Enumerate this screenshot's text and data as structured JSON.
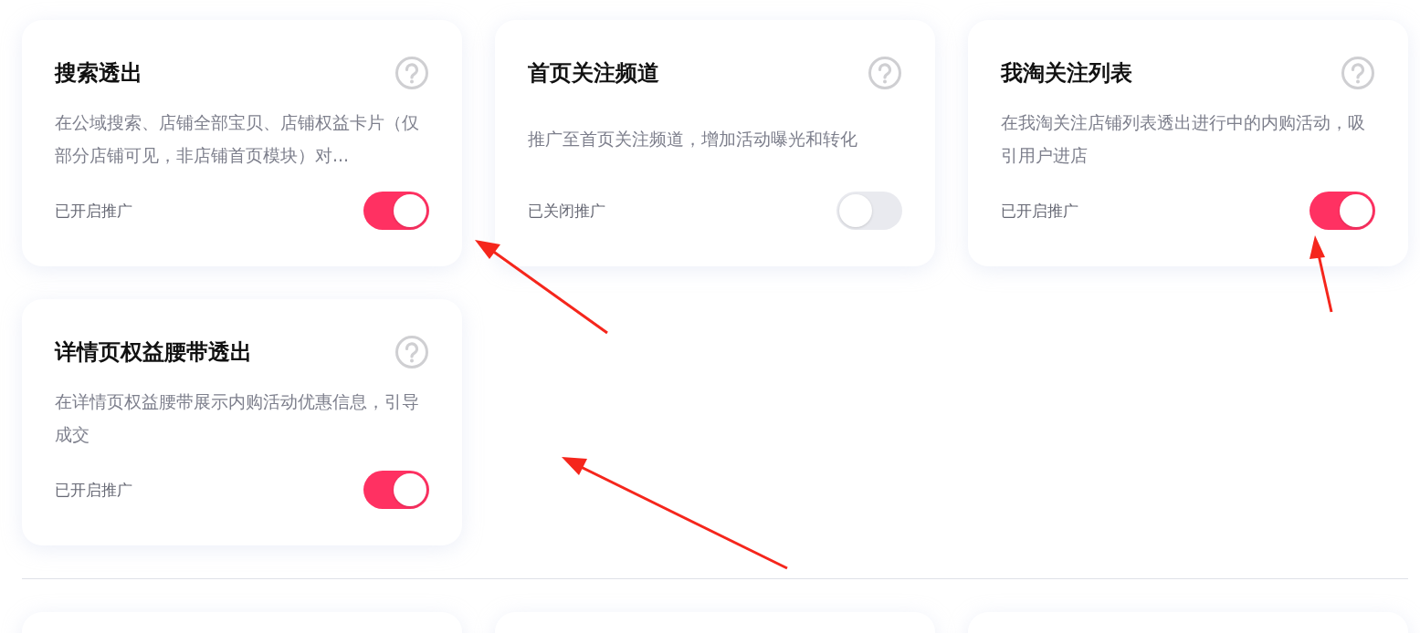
{
  "cards": [
    {
      "title": "搜索透出",
      "description": "在公域搜索、店铺全部宝贝、店铺权益卡片（仅部分店铺可见，非店铺首页模块）对...",
      "status": "已开启推广",
      "on": true
    },
    {
      "title": "首页关注频道",
      "description": "推广至首页关注频道，增加活动曝光和转化",
      "status": "已关闭推广",
      "on": false
    },
    {
      "title": "我淘关注列表",
      "description": "在我淘关注店铺列表透出进行中的内购活动，吸引用户进店",
      "status": "已开启推广",
      "on": true
    },
    {
      "title": "详情页权益腰带透出",
      "description": "在详情页权益腰带展示内购活动优惠信息，引导成交",
      "status": "已开启推广",
      "on": true
    }
  ]
}
